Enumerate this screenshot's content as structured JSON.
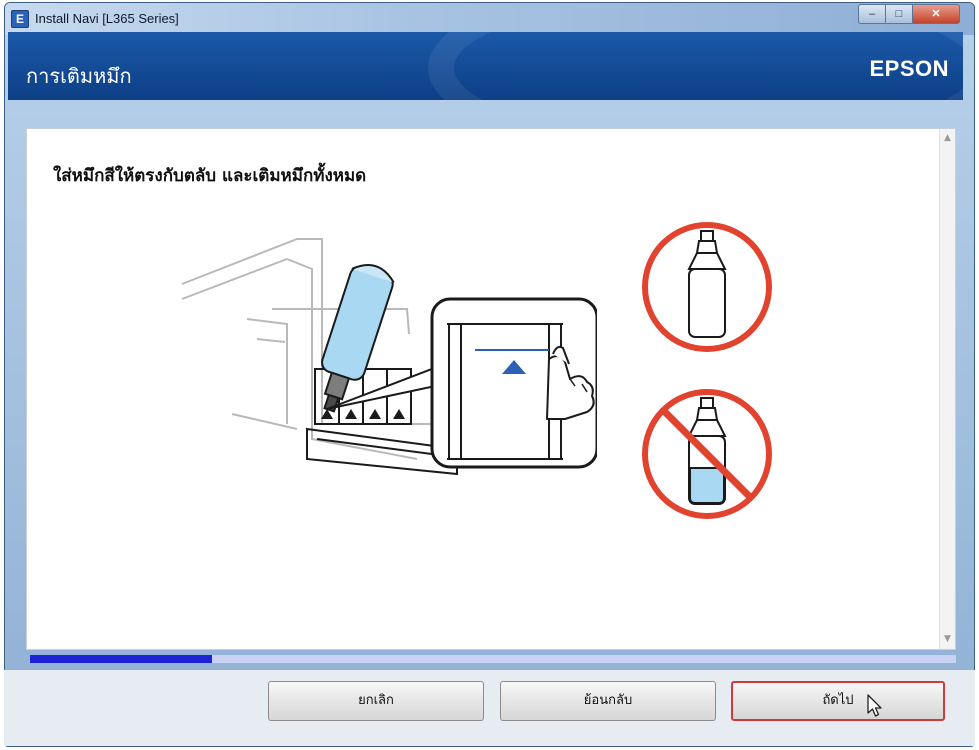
{
  "window": {
    "title": "Install Navi [L365 Series]",
    "app_icon_letter": "E",
    "controls": {
      "minimize": "–",
      "maximize": "□",
      "close": "✕"
    }
  },
  "banner": {
    "title": "การเติมหมึก",
    "brand": "EPSON"
  },
  "content": {
    "instruction": "ใส่หมึกสีให้ตรงกับตลับ และเติมหมึกทั้งหมด"
  },
  "scrollbar": {
    "up": "▲",
    "down": "▼"
  },
  "progress": {
    "fraction": 0.197
  },
  "buttons": {
    "cancel": "ยกเลิก",
    "back": "ย้อนกลับ",
    "next": "ถัดไป"
  },
  "icons": {
    "ok_bottle": "empty-ink-bottle-icon",
    "bad_bottle": "partially-filled-ink-bottle-prohibited-icon"
  },
  "colors": {
    "banner": "#1b59a8",
    "progress_fill": "#1d24d8",
    "highlight": "#d03a3a",
    "ink": "#a9d8f2"
  }
}
